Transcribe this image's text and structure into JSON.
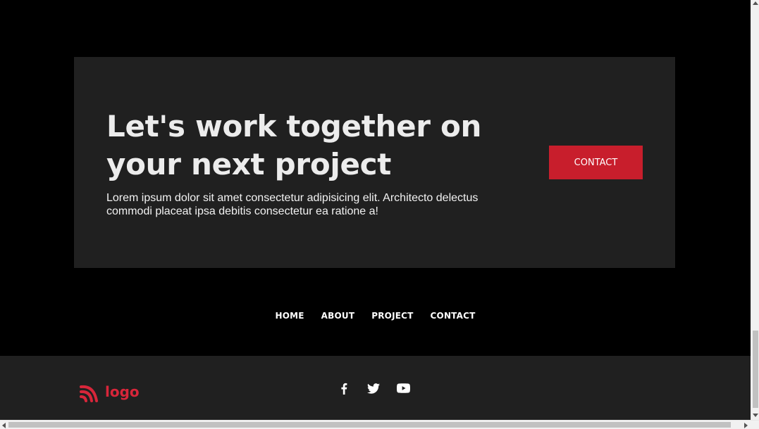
{
  "cta": {
    "heading": "Let's work together on your next project",
    "text": "Lorem ipsum dolor sit amet consectetur adipisicing elit. Architecto delectus commodi placeat ipsa debitis consectetur ea ratione a!",
    "button_label": "CONTACT"
  },
  "footer_nav": {
    "items": [
      {
        "label": "HOME"
      },
      {
        "label": "ABOUT"
      },
      {
        "label": "PROJECT"
      },
      {
        "label": "CONTACT"
      }
    ]
  },
  "brand": {
    "logo_text": "logo",
    "accent": "#d8263a"
  },
  "social": {
    "icons": [
      "facebook-icon",
      "twitter-icon",
      "youtube-icon"
    ]
  },
  "colors": {
    "background": "#000000",
    "panel": "#202020",
    "button": "#c81e2c",
    "text": "#ececec"
  }
}
